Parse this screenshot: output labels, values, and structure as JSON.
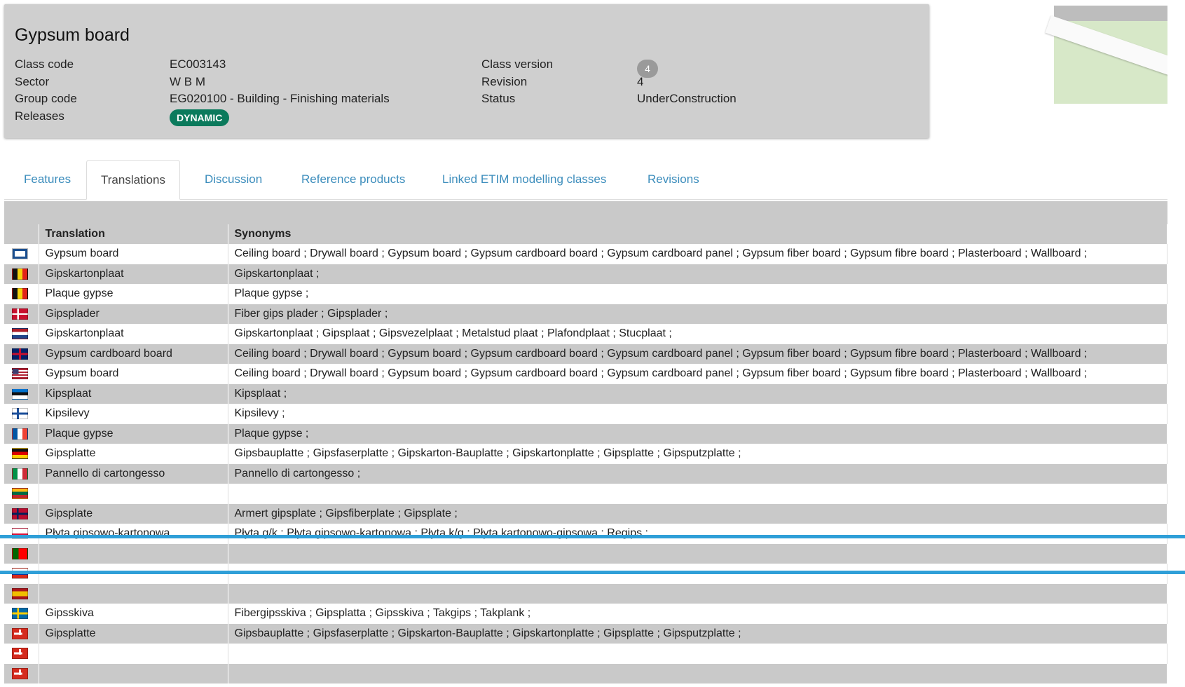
{
  "header": {
    "title": "Gypsum board",
    "fields": {
      "class_code_label": "Class code",
      "class_code": "EC003143",
      "sector_label": "Sector",
      "sector": "W B M",
      "group_code_label": "Group code",
      "group_code": "EG020100 - Building - Finishing materials",
      "releases_label": "Releases",
      "release_badge": "DYNAMIC",
      "class_version_label": "Class version",
      "class_version": "4",
      "revision_label": "Revision",
      "revision": "4",
      "status_label": "Status",
      "status": "UnderConstruction"
    }
  },
  "tabs": [
    "Features",
    "Translations",
    "Discussion",
    "Reference products",
    "Linked ETIM modelling classes",
    "Revisions"
  ],
  "active_tab": "Translations",
  "table": {
    "headers": [
      "",
      "Translation",
      "Synonyms"
    ],
    "rows": [
      {
        "flag": "international",
        "translation": "Gypsum board",
        "synonyms": "Ceiling board ; Drywall board ; Gypsum board ; Gypsum cardboard board ; Gypsum cardboard panel ; Gypsum fiber board ; Gypsum fibre board ; Plasterboard ; Wallboard ;"
      },
      {
        "flag": "belgium",
        "translation": "Gipskartonplaat",
        "synonyms": "Gipskartonplaat ;"
      },
      {
        "flag": "belgium",
        "translation": "Plaque gypse",
        "synonyms": "Plaque gypse ;"
      },
      {
        "flag": "denmark",
        "translation": "Gipsplader",
        "synonyms": "Fiber gips plader ; Gipsplader ;"
      },
      {
        "flag": "netherlands",
        "translation": "Gipskartonplaat",
        "synonyms": "Gipskartonplaat ; Gipsplaat ; Gipsvezelplaat ; Metalstud plaat ; Plafondplaat ; Stucplaat ;"
      },
      {
        "flag": "united-kingdom",
        "translation": "Gypsum cardboard board",
        "synonyms": "Ceiling board ; Drywall board ; Gypsum board ; Gypsum cardboard board ; Gypsum cardboard panel ; Gypsum fiber board ; Gypsum fibre board ; Plasterboard ; Wallboard ;"
      },
      {
        "flag": "united-states",
        "translation": "Gypsum board",
        "synonyms": "Ceiling board ; Drywall board ; Gypsum board ; Gypsum cardboard board ; Gypsum cardboard panel ; Gypsum fiber board ; Gypsum fibre board ; Plasterboard ; Wallboard ;"
      },
      {
        "flag": "estonia",
        "translation": "Kipsplaat",
        "synonyms": "Kipsplaat ;"
      },
      {
        "flag": "finland",
        "translation": "Kipsilevy",
        "synonyms": "Kipsilevy ;"
      },
      {
        "flag": "france",
        "translation": "Plaque gypse",
        "synonyms": "Plaque gypse ;"
      },
      {
        "flag": "germany",
        "translation": "Gipsplatte",
        "synonyms": "Gipsbauplatte ; Gipsfaserplatte ; Gipskarton-Bauplatte ; Gipskartonplatte ; Gipsplatte ; Gipsputzplatte ;"
      },
      {
        "flag": "italy",
        "translation": "Pannello di cartongesso",
        "synonyms": "Pannello di cartongesso ;"
      },
      {
        "flag": "lithuania",
        "translation": "",
        "synonyms": ""
      },
      {
        "flag": "norway",
        "translation": "Gipsplate",
        "synonyms": "Armert gipsplate ; Gipsfiberplate ; Gipsplate ;"
      },
      {
        "flag": "poland",
        "translation": "Płyta gipsowo-kartonowa",
        "synonyms": "Płyta g/k ; Płyta gipsowo-kartonowa ; Płyta k/g ; Płyta kartonowo-gipsowa ; Regips ;"
      },
      {
        "flag": "portugal",
        "translation": "",
        "synonyms": ""
      },
      {
        "flag": "russia",
        "translation": "",
        "synonyms": ""
      },
      {
        "flag": "spain",
        "translation": "",
        "synonyms": ""
      },
      {
        "flag": "sweden",
        "translation": "Gipsskiva",
        "synonyms": "Fibergipsskiva ; Gipsplatta ; Gipsskiva ; Takgips ; Takplank ;"
      },
      {
        "flag": "switzerland",
        "translation": "Gipsplatte",
        "synonyms": "Gipsbauplatte ; Gipsfaserplatte ; Gipskarton-Bauplatte ; Gipskartonplatte ; Gipsplatte ; Gipsputzplatte ;"
      },
      {
        "flag": "switzerland",
        "translation": "",
        "synonyms": ""
      },
      {
        "flag": "switzerland",
        "translation": "",
        "synonyms": ""
      }
    ]
  },
  "colors": {
    "accent": "#3c8dbc",
    "badge": "#0b7a5c",
    "selection_line": "#2f9fd8"
  }
}
